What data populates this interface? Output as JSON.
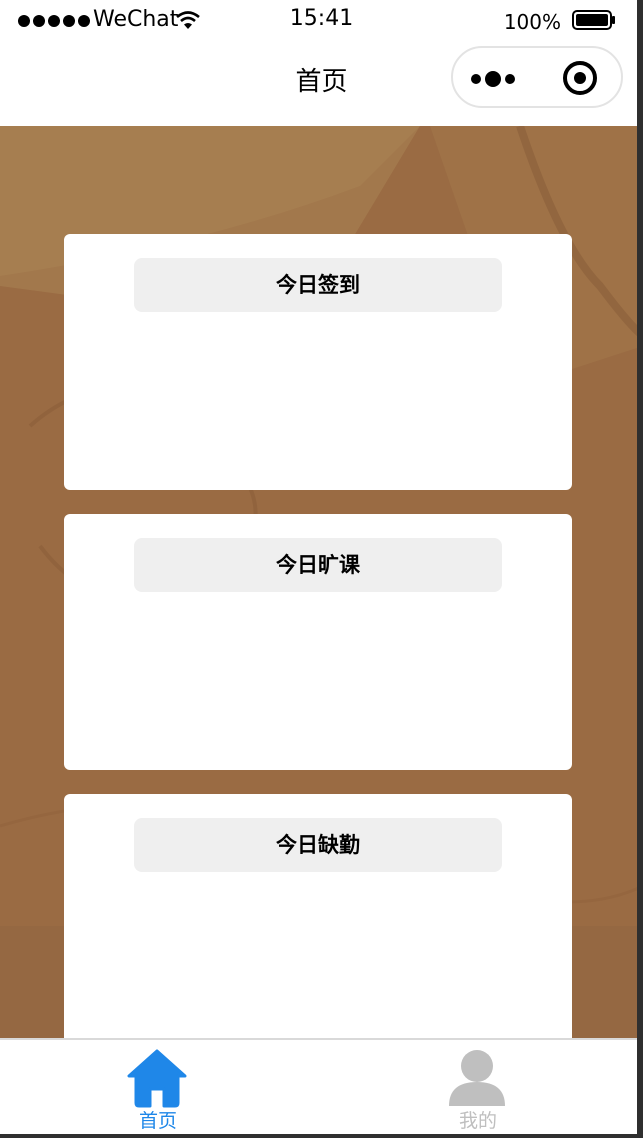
{
  "status_bar": {
    "carrier": "WeChat",
    "time": "15:41",
    "battery_percent": "100%",
    "battery_level": 1.0,
    "signal_bars": 5,
    "icons": [
      "signal-dots-icon",
      "wifi-icon",
      "battery-icon"
    ]
  },
  "nav_bar": {
    "title": "首页",
    "capsule_icons": [
      "more-icon",
      "close-target-icon"
    ]
  },
  "cards": [
    {
      "title": "今日签到"
    },
    {
      "title": "今日旷课"
    },
    {
      "title": "今日缺勤"
    }
  ],
  "tab_bar": {
    "items": [
      {
        "label": "首页",
        "icon": "home-icon",
        "active": true
      },
      {
        "label": "我的",
        "icon": "user-icon",
        "active": false
      }
    ]
  },
  "colors": {
    "active_tab": "#1f87e8",
    "inactive_tab": "#bfbfbf",
    "background": "#9a6b43",
    "card_title_bg": "#efefef"
  }
}
